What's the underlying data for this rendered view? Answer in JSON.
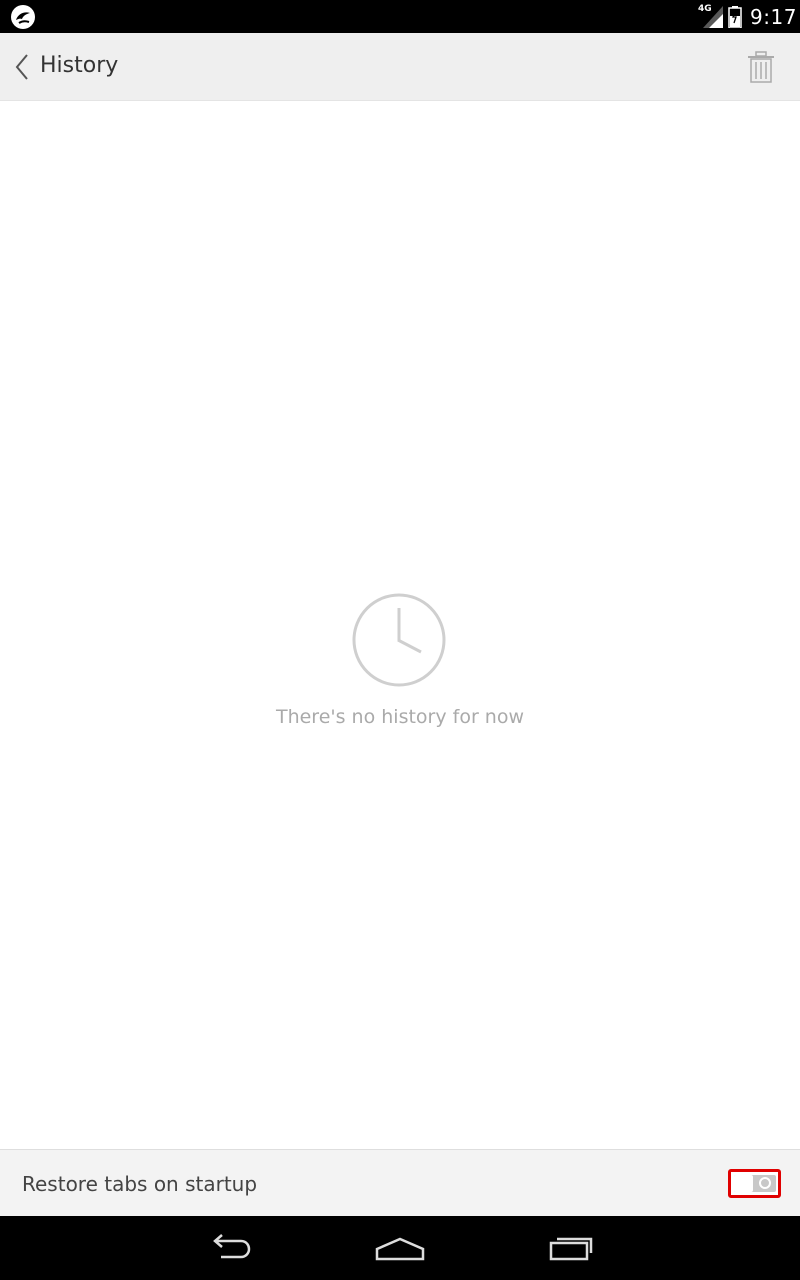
{
  "status_bar": {
    "network": "4G",
    "time": "9:17",
    "icons": [
      "app-notification-icon",
      "signal-icon",
      "battery-icon"
    ]
  },
  "header": {
    "title": "History",
    "back_icon": "chevron-left-icon",
    "clear_icon": "trash-icon"
  },
  "empty_state": {
    "icon": "clock-icon",
    "message": "There's no history for now"
  },
  "settings": {
    "restore_tabs_label": "Restore tabs on startup",
    "restore_tabs_enabled": false
  },
  "nav_bar": {
    "icons": [
      "back-icon",
      "home-icon",
      "recents-icon"
    ]
  },
  "colors": {
    "header_bg": "#efefef",
    "empty_text": "#aaaaaa",
    "highlight": "#e00000"
  }
}
